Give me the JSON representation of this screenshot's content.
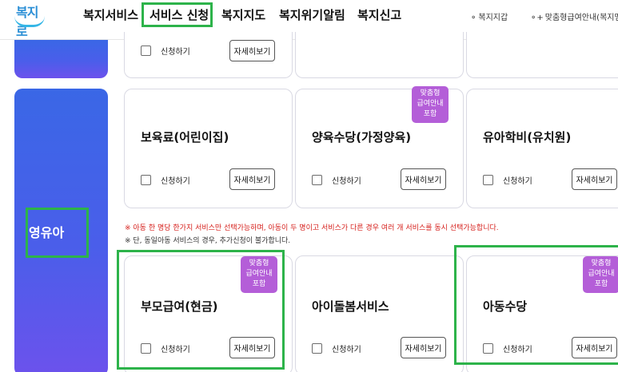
{
  "header": {
    "logo_text": "복지로",
    "nav": [
      "복지서비스",
      "서비스 신청",
      "복지지도",
      "복지위기알림",
      "복지신고"
    ],
    "utility": [
      "복지지갑",
      "맞춤형급여안내(복지멤"
    ]
  },
  "categories": {
    "infant": "영유아"
  },
  "common": {
    "apply_label": "신청하기",
    "detail_label": "자세히보기"
  },
  "badge_lines": [
    "맞춤형",
    "급여안내",
    "포함"
  ],
  "cards_row1": [
    {
      "title": "보육료(어린이집)"
    },
    {
      "title": "양육수당(가정양육)"
    },
    {
      "title": "유아학비(유치원)"
    }
  ],
  "notices": [
    "※ 아동 한 명당 한가지 서비스만 선택가능하며, 아동이 두 명이고 서비스가 다른 경우 여러 개 서비스를 동시 선택가능합니다.",
    "※ 단, 동일아동 서비스의 경우, 추가신청이 불가합니다."
  ],
  "cards_row2": [
    {
      "title": "부모급여(현금)"
    },
    {
      "title": "아이돌봄서비스"
    },
    {
      "title": "아동수당"
    }
  ],
  "colors": {
    "accent_green": "#2db34a",
    "category_gradient_start": "#3a67e6",
    "badge": "#b45ed8",
    "notice_red": "#d6201c"
  }
}
